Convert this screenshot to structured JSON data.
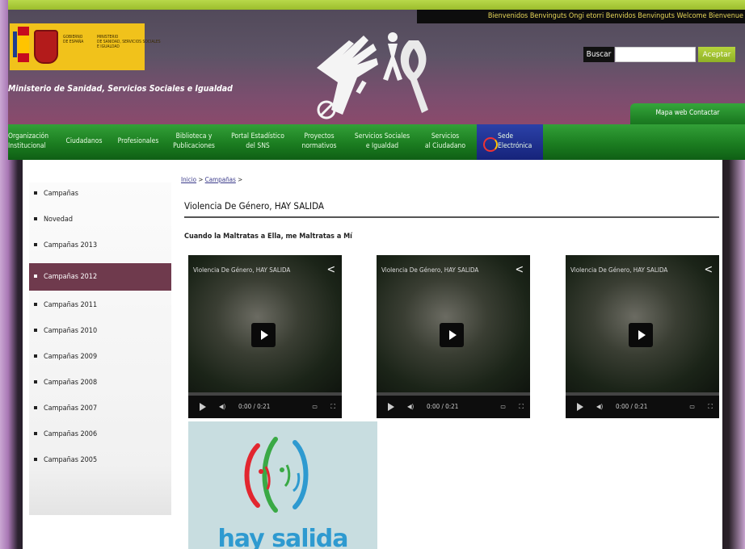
{
  "header": {
    "languages": "Bienvenidos  Benvinguts  Ongi etorri  Benvidos  Benvinguts  Welcome  Bienvenue",
    "ministry_name": "Ministerio de Sanidad, Servicios Sociales e Igualdad",
    "gov_logo": {
      "line1": "GOBIERNO\nDE ESPAÑA",
      "line2": "MINISTERIO\nDE SANIDAD, SERVICIOS SOCIALES\nE IGUALDAD"
    },
    "search": {
      "label": "Buscar",
      "placeholder": "",
      "button": "Aceptar"
    },
    "utility_links": "Mapa web  Contactar"
  },
  "nav": {
    "items": [
      "Organización\nInstitucional",
      "Ciudadanos",
      "Profesionales",
      "Biblioteca y\nPublicaciones",
      "Portal Estadístico\ndel SNS",
      "Proyectos\nnormativos",
      "Servicios Sociales\ne Igualdad",
      "Servicios\nal Ciudadano"
    ],
    "sede": "Sede\nElectrónica"
  },
  "sidebar": {
    "items": [
      {
        "label": "Campañas",
        "active": false
      },
      {
        "label": "Novedad",
        "active": false
      },
      {
        "label": "Campañas 2013",
        "active": false
      },
      {
        "label": "Campañas 2012",
        "active": true
      },
      {
        "label": "Campañas 2011",
        "active": false
      },
      {
        "label": "Campañas 2010",
        "active": false
      },
      {
        "label": "Campañas 2009",
        "active": false
      },
      {
        "label": "Campañas 2008",
        "active": false
      },
      {
        "label": "Campañas 2007",
        "active": false
      },
      {
        "label": "Campañas 2006",
        "active": false
      },
      {
        "label": "Campañas 2005",
        "active": false
      }
    ]
  },
  "main": {
    "breadcrumb": {
      "home": "Inicio",
      "separator": ">",
      "section": "Campañas"
    },
    "title": "Violencia De Género, HAY SALIDA",
    "subtitle": "Cuando la Maltratas a Ella, me Maltratas a Mí",
    "videos": [
      {
        "title": "Violencia De Género, HAY SALIDA",
        "time": "0:00 / 0:21"
      },
      {
        "title": "Violencia De Género, HAY SALIDA",
        "time": "0:00 / 0:21"
      },
      {
        "title": "Violencia De Género, HAY SALIDA",
        "time": "0:00 / 0:21"
      }
    ],
    "campaign_image_caption": "hay salida"
  },
  "colors": {
    "accent_green": "#1b7d20",
    "sidebar_active": "#6f3a4d",
    "campaign_blue": "#2e9ad0"
  }
}
